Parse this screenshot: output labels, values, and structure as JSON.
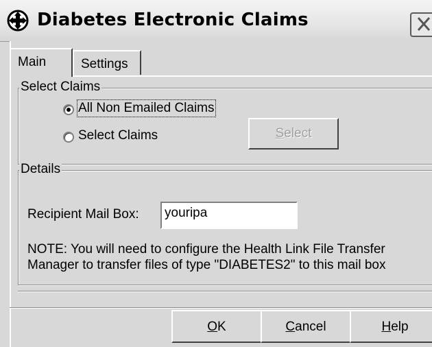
{
  "window": {
    "title": "Diabetes Electronic Claims",
    "close_label": "✕"
  },
  "tabs": [
    {
      "label": "Main",
      "selected": true
    },
    {
      "label": "Settings",
      "selected": false
    }
  ],
  "select_claims": {
    "legend": "Select Claims",
    "options": [
      {
        "label": "All Non Emailed Claims",
        "checked": true
      },
      {
        "label": "Select Claims",
        "checked": false
      }
    ],
    "select_button": {
      "label": "Select",
      "enabled": false
    }
  },
  "details": {
    "legend": "Details",
    "recipient_label": "Recipient Mail Box:",
    "recipient_value": "youripa",
    "note_line1": "NOTE: You will need to configure the Health Link File Transfer",
    "note_line2": "Manager to transfer files of type \"DIABETES2\" to this mail box"
  },
  "buttons": {
    "ok": "OK",
    "cancel": "Cancel",
    "help": "Help"
  },
  "icons": {
    "app": "move-cross-icon",
    "close": "close-icon"
  }
}
